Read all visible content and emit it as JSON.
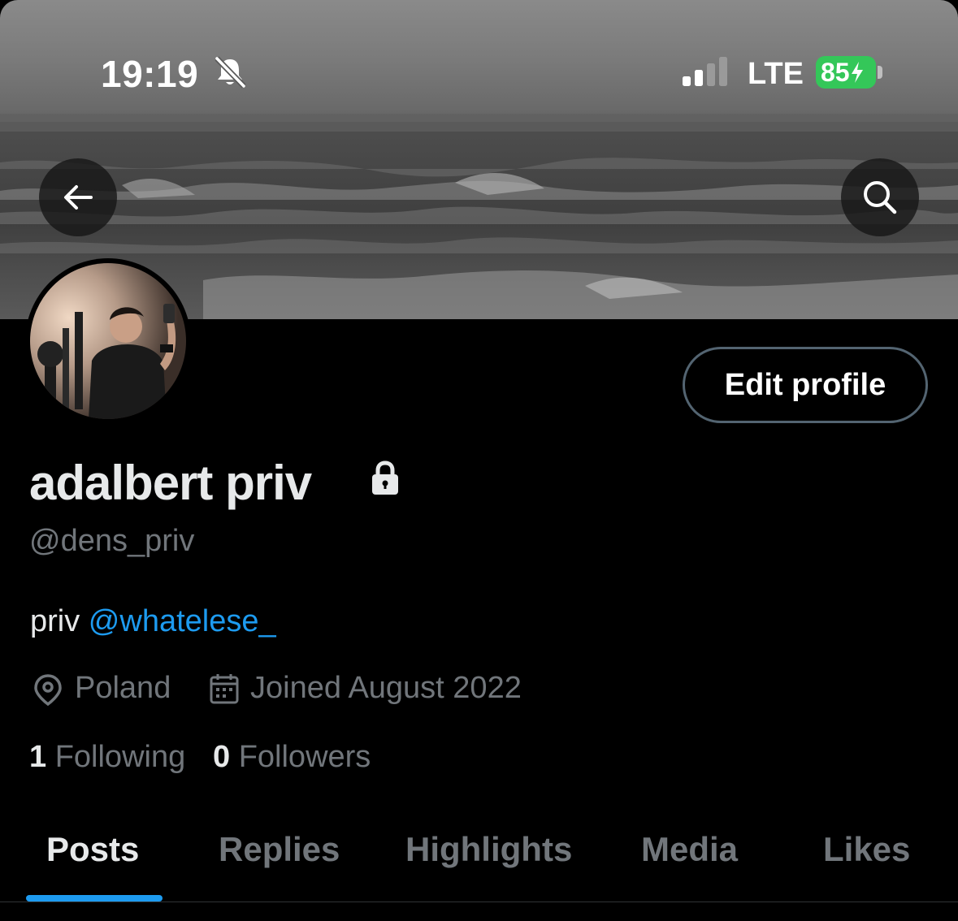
{
  "status_bar": {
    "time": "19:19",
    "network": "LTE",
    "battery": "85",
    "battery_color": "#34c759",
    "icons": [
      "bell-slash-icon",
      "signal-icon",
      "charging-bolt-icon"
    ]
  },
  "header": {
    "back_icon": "arrow-left-icon",
    "search_icon": "search-icon"
  },
  "profile": {
    "edit_label": "Edit profile",
    "display_name": "adalbert priv",
    "protected_icon": "lock-icon",
    "handle": "@dens_priv",
    "bio_text": "priv ",
    "bio_mention": "@whatelese_",
    "location": "Poland",
    "joined": "Joined August 2022",
    "following_count": "1",
    "following_label": "Following",
    "followers_count": "0",
    "followers_label": "Followers"
  },
  "tabs": [
    {
      "label": "Posts",
      "active": true
    },
    {
      "label": "Replies",
      "active": false
    },
    {
      "label": "Highlights",
      "active": false
    },
    {
      "label": "Media",
      "active": false
    },
    {
      "label": "Likes",
      "active": false
    }
  ],
  "colors": {
    "background": "#000000",
    "accent": "#1d9bf0",
    "secondary_text": "#71767b",
    "primary_text": "#e7e9ea"
  }
}
